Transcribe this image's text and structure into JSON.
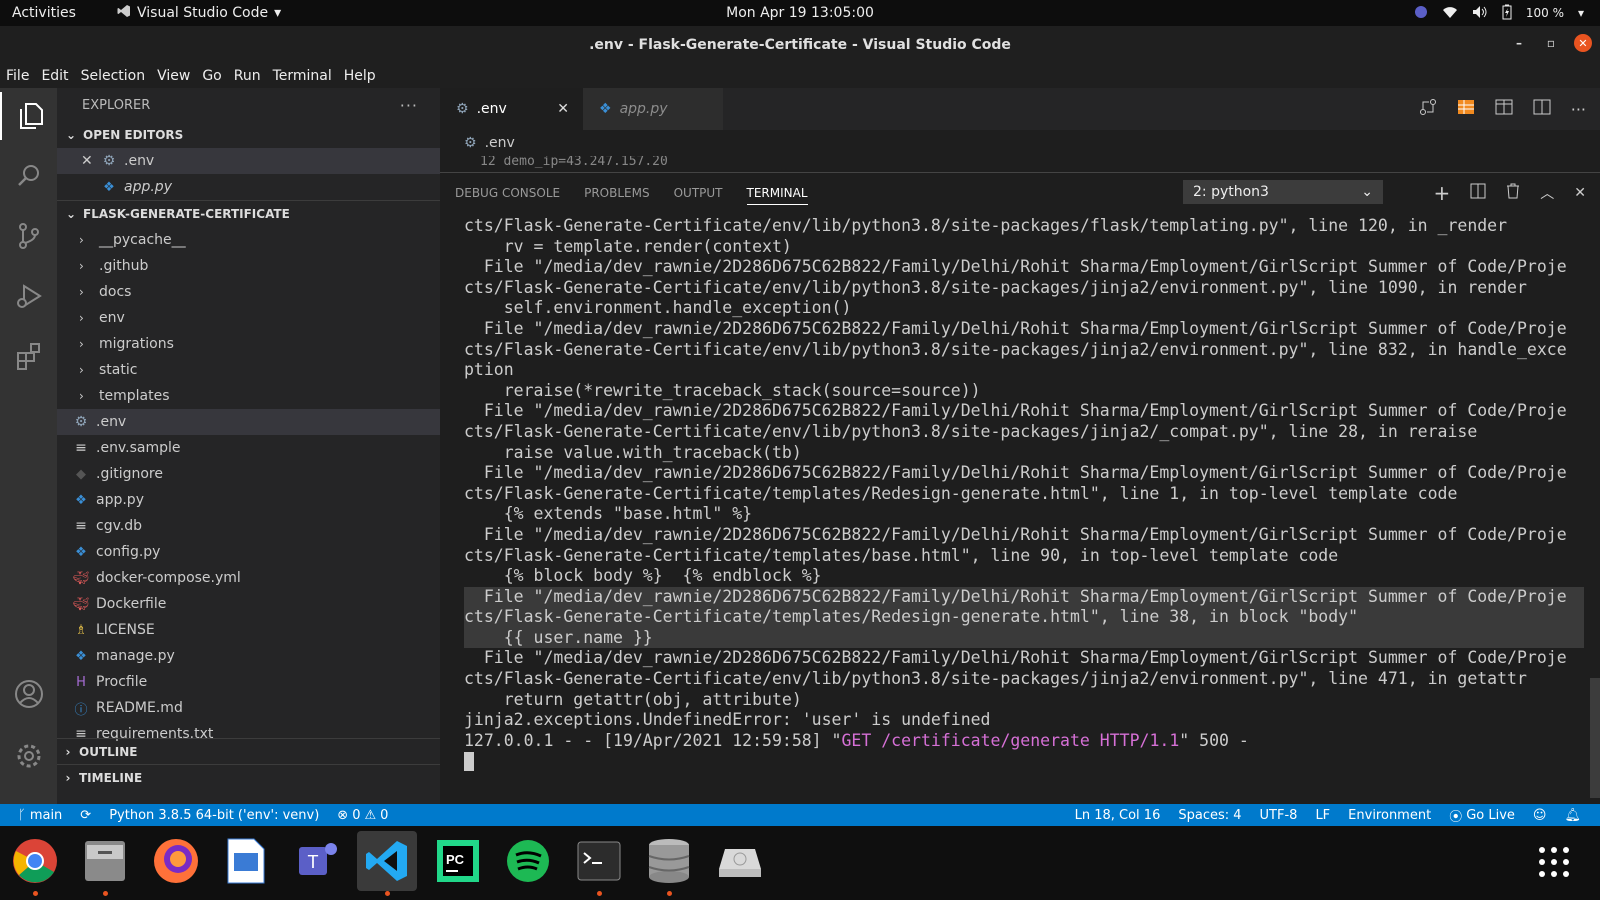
{
  "gnome": {
    "activities": "Activities",
    "app_name": "Visual Studio Code",
    "clock": "Mon Apr 19  13:05:00",
    "battery": "100 %"
  },
  "window": {
    "title": ".env - Flask-Generate-Certificate - Visual Studio Code"
  },
  "menu": [
    "File",
    "Edit",
    "Selection",
    "View",
    "Go",
    "Run",
    "Terminal",
    "Help"
  ],
  "sidebar": {
    "title": "EXPLORER",
    "open_editors_title": "OPEN EDITORS",
    "open_editors": [
      {
        "name": ".env",
        "icon": "gear-icon"
      },
      {
        "name": "app.py",
        "icon": "python-icon"
      }
    ],
    "project_title": "FLASK-GENERATE-CERTIFICATE",
    "folders": [
      "__pycache__",
      ".github",
      "docs",
      "env",
      "migrations",
      "static",
      "templates"
    ],
    "files": [
      {
        "name": ".env",
        "icon": "gear-icon"
      },
      {
        "name": ".env.sample",
        "icon": "lines-icon"
      },
      {
        "name": ".gitignore",
        "icon": "git-icon"
      },
      {
        "name": "app.py",
        "icon": "python-icon"
      },
      {
        "name": "cgv.db",
        "icon": "lines-icon"
      },
      {
        "name": "config.py",
        "icon": "python-icon"
      },
      {
        "name": "docker-compose.yml",
        "icon": "docker-icon"
      },
      {
        "name": "Dockerfile",
        "icon": "docker-icon"
      },
      {
        "name": "LICENSE",
        "icon": "license-icon"
      },
      {
        "name": "manage.py",
        "icon": "python-icon"
      },
      {
        "name": "Procfile",
        "icon": "heroku-icon"
      },
      {
        "name": "README.md",
        "icon": "info-icon"
      },
      {
        "name": "requirements.txt",
        "icon": "lines-icon"
      }
    ],
    "outline": "OUTLINE",
    "timeline": "TIMELINE"
  },
  "editor": {
    "tabs": [
      {
        "label": ".env",
        "icon": "gear-icon",
        "active": true
      },
      {
        "label": "app.py",
        "icon": "python-icon",
        "active": false
      }
    ],
    "breadcrumb": ".env",
    "peek_line": "12    demo_ip=43.247.157.20"
  },
  "panel": {
    "tabs": [
      "DEBUG CONSOLE",
      "PROBLEMS",
      "OUTPUT",
      "TERMINAL"
    ],
    "active_tab": "TERMINAL",
    "terminal_select": "2: python3",
    "lines": [
      "cts/Flask-Generate-Certificate/env/lib/python3.8/site-packages/flask/templating.py\", line 120, in _render",
      "    rv = template.render(context)",
      "  File \"/media/dev_rawnie/2D286D675C62B822/Family/Delhi/Rohit Sharma/Employment/GirlScript Summer of Code/Proje",
      "cts/Flask-Generate-Certificate/env/lib/python3.8/site-packages/jinja2/environment.py\", line 1090, in render",
      "    self.environment.handle_exception()",
      "  File \"/media/dev_rawnie/2D286D675C62B822/Family/Delhi/Rohit Sharma/Employment/GirlScript Summer of Code/Proje",
      "cts/Flask-Generate-Certificate/env/lib/python3.8/site-packages/jinja2/environment.py\", line 832, in handle_exce",
      "ption",
      "    reraise(*rewrite_traceback_stack(source=source))",
      "  File \"/media/dev_rawnie/2D286D675C62B822/Family/Delhi/Rohit Sharma/Employment/GirlScript Summer of Code/Proje",
      "cts/Flask-Generate-Certificate/env/lib/python3.8/site-packages/jinja2/_compat.py\", line 28, in reraise",
      "    raise value.with_traceback(tb)",
      "  File \"/media/dev_rawnie/2D286D675C62B822/Family/Delhi/Rohit Sharma/Employment/GirlScript Summer of Code/Proje",
      "cts/Flask-Generate-Certificate/templates/Redesign-generate.html\", line 1, in top-level template code",
      "    {% extends \"base.html\" %}",
      "  File \"/media/dev_rawnie/2D286D675C62B822/Family/Delhi/Rohit Sharma/Employment/GirlScript Summer of Code/Proje",
      "cts/Flask-Generate-Certificate/templates/base.html\", line 90, in top-level template code",
      "    {% block body %}  {% endblock %}",
      "  File \"/media/dev_rawnie/2D286D675C62B822/Family/Delhi/Rohit Sharma/Employment/GirlScript Summer of Code/Proje",
      "cts/Flask-Generate-Certificate/templates/Redesign-generate.html\", line 38, in block \"body\"",
      "    {{ user.name }}",
      "  File \"/media/dev_rawnie/2D286D675C62B822/Family/Delhi/Rohit Sharma/Employment/GirlScript Summer of Code/Proje",
      "cts/Flask-Generate-Certificate/env/lib/python3.8/site-packages/jinja2/environment.py\", line 471, in getattr",
      "    return getattr(obj, attribute)",
      "jinja2.exceptions.UndefinedError: 'user' is undefined"
    ],
    "highlight_lines": [
      18,
      19,
      20
    ],
    "log_prefix": "127.0.0.1 - - [19/Apr/2021 12:59:58] \"",
    "log_request": "GET /certificate/generate HTTP/1.1",
    "log_suffix": "\" 500 -"
  },
  "statusbar": {
    "branch": "main",
    "python": "Python 3.8.5 64-bit ('env': venv)",
    "errors": "0",
    "warnings": "0",
    "position": "Ln 18, Col 16",
    "spaces": "Spaces: 4",
    "encoding": "UTF-8",
    "eol": "LF",
    "language": "Environment",
    "golive": "Go Live"
  },
  "dock": [
    {
      "name": "chrome-icon"
    },
    {
      "name": "files-icon"
    },
    {
      "name": "firefox-icon"
    },
    {
      "name": "writer-icon"
    },
    {
      "name": "teams-icon"
    },
    {
      "name": "vscode-icon"
    },
    {
      "name": "pycharm-icon"
    },
    {
      "name": "spotify-icon"
    },
    {
      "name": "terminal-icon"
    },
    {
      "name": "database-icon"
    },
    {
      "name": "drive-icon"
    }
  ],
  "colors": {
    "accent": "#007acc",
    "ubuntu_orange": "#e95420",
    "request_magenta": "#d670d6"
  }
}
